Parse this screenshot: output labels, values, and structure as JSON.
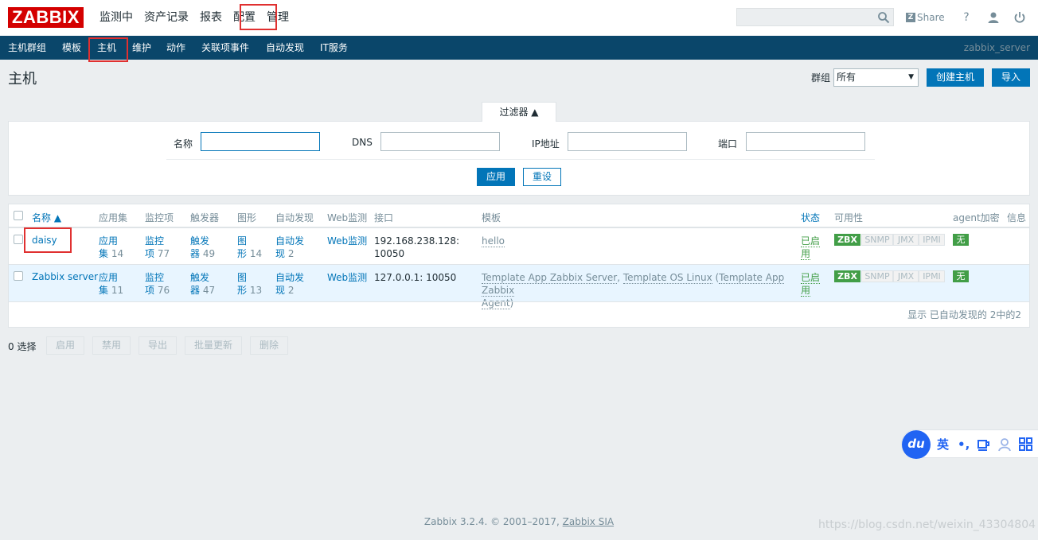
{
  "header": {
    "logo": "ZABBIX",
    "nav": [
      "监测中",
      "资产记录",
      "报表",
      "配置",
      "管理"
    ],
    "share_label": "Share",
    "help_glyph": "?"
  },
  "subnav": {
    "items": [
      "主机群组",
      "模板",
      "主机",
      "维护",
      "动作",
      "关联项事件",
      "自动发现",
      "IT服务"
    ],
    "server": "zabbix_server"
  },
  "page": {
    "title": "主机",
    "group_label": "群组",
    "group_value": "所有",
    "create_button": "创建主机",
    "import_button": "导入"
  },
  "filter": {
    "tab_label": "过滤器 ▲",
    "name_label": "名称",
    "dns_label": "DNS",
    "ip_label": "IP地址",
    "port_label": "端口",
    "apply_button": "应用",
    "reset_button": "重设"
  },
  "table": {
    "headers": {
      "name": "名称 ▲",
      "apps": "应用集",
      "items": "监控项",
      "triggers": "触发器",
      "graphs": "图形",
      "discovery": "自动发现",
      "web": "Web监测",
      "interface": "接口",
      "templates": "模板",
      "status": "状态",
      "availability": "可用性",
      "agent_enc": "agent加密",
      "info": "信息"
    },
    "rows": [
      {
        "name": "daisy",
        "apps_l1": "应用",
        "apps_l2": "集",
        "apps_n": "14",
        "items_l1": "监控",
        "items_l2": "项",
        "items_n": "77",
        "triggers_l1": "触发",
        "triggers_l2": "器",
        "triggers_n": "49",
        "graphs_l1": "图",
        "graphs_l2": "形",
        "graphs_n": "14",
        "disc_l1": "自动发",
        "disc_l2": "现",
        "disc_n": "2",
        "web": "Web监测",
        "iface_l1": "192.168.238.128:",
        "iface_l2": "10050",
        "tpl_1": "hello",
        "status_l1": "已启",
        "status_l2": "用",
        "avail": [
          "ZBX",
          "SNMP",
          "JMX",
          "IPMI"
        ],
        "enc": "无"
      },
      {
        "name": "Zabbix server",
        "apps_l1": "应用",
        "apps_l2": "集",
        "apps_n": "11",
        "items_l1": "监控",
        "items_l2": "项",
        "items_n": "76",
        "triggers_l1": "触发",
        "triggers_l2": "器",
        "triggers_n": "47",
        "graphs_l1": "图",
        "graphs_l2": "形",
        "graphs_n": "13",
        "disc_l1": "自动发",
        "disc_l2": "现",
        "disc_n": "2",
        "web": "Web监测",
        "iface_l1": "127.0.0.1: 10050",
        "tpl_1": "Template App Zabbix Server",
        "tpl_2": "Template OS Linux",
        "tpl_3a": "Template App Zabbix",
        "tpl_3b": "Agent",
        "status_l1": "已启",
        "status_l2": "用",
        "avail": [
          "ZBX",
          "SNMP",
          "JMX",
          "IPMI"
        ],
        "enc": "无"
      }
    ],
    "footer": "显示 已自动发现的 2中的2"
  },
  "actions": {
    "selected": "0 选择",
    "buttons": [
      "启用",
      "禁用",
      "导出",
      "批量更新",
      "删除"
    ]
  },
  "ime": {
    "logo": "du",
    "lang": "英",
    "punct": "•,"
  },
  "footer": {
    "text": "Zabbix 3.2.4. © 2001–2017,",
    "link": "Zabbix SIA"
  },
  "watermark": "https://blog.csdn.net/weixin_43304804",
  "colors": {
    "brand_red": "#d40000",
    "subnav_bg": "#0a466a",
    "primary_blue": "#0275b8",
    "ok_green": "#429e47",
    "highlight_box": "#e03030"
  }
}
